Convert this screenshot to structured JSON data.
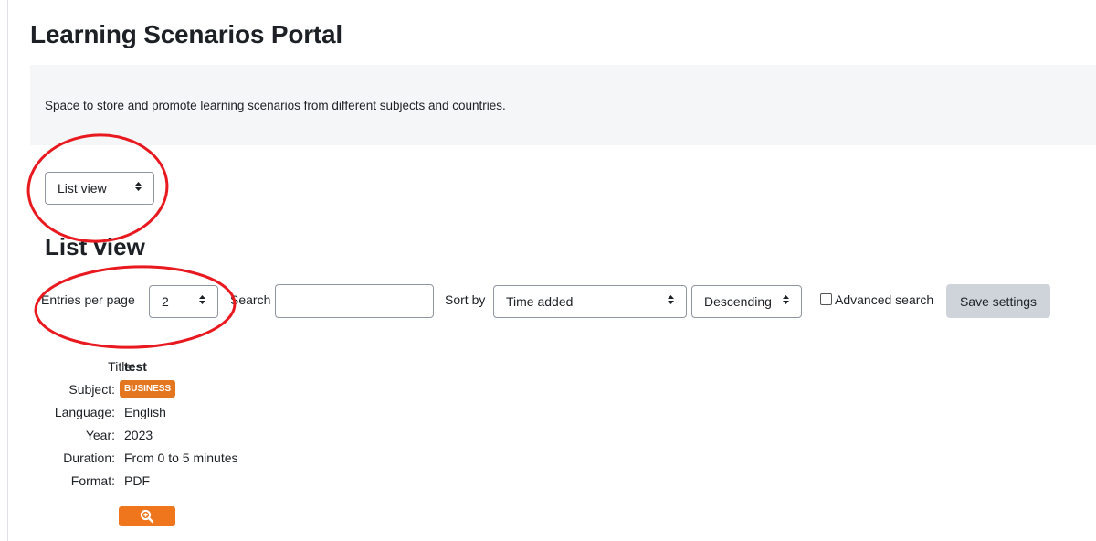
{
  "page": {
    "title": "Learning Scenarios Portal",
    "intro": "Space to store and promote learning scenarios from different subjects and countries."
  },
  "view_selector": {
    "value": "List view"
  },
  "list": {
    "heading": "List view",
    "controls": {
      "entries_label": "Entries per page",
      "entries_value": "2",
      "search_label": "Search",
      "search_value": "",
      "sort_by_label": "Sort by",
      "sort_by_value": "Time added",
      "order_value": "Descending",
      "advanced_search_label": "Advanced search",
      "advanced_search_checked": false,
      "save_button": "Save settings"
    },
    "entry": {
      "title_label": "Title:",
      "title_value": "test",
      "subject_label": "Subject:",
      "subject_value": "BUSINESS",
      "language_label": "Language:",
      "language_value": "English",
      "year_label": "Year:",
      "year_value": "2023",
      "duration_label": "Duration:",
      "duration_value": "From 0 to 5 minutes",
      "format_label": "Format:",
      "format_value": "PDF",
      "view_button_icon": "zoom-in-icon"
    }
  },
  "colors": {
    "accent": "#f0761e",
    "badge": "#e4761f",
    "annotation": "#e8191f",
    "intro_bg": "#f5f6f8",
    "save_button_bg": "#ced4da"
  }
}
